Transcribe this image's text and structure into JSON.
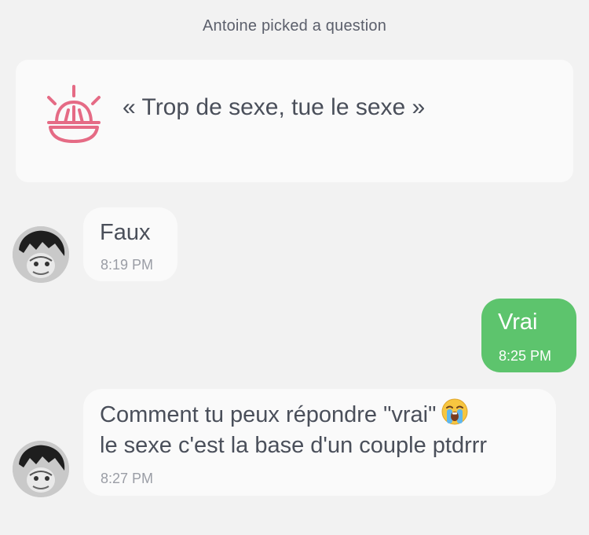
{
  "system_note": "Antoine picked a question",
  "question": {
    "text": "« Trop de sexe, tue le sexe »",
    "icon": "juicer-icon",
    "icon_color": "#e56b85"
  },
  "messages": [
    {
      "direction": "incoming",
      "text": "Faux",
      "time": "8:19 PM"
    },
    {
      "direction": "outgoing",
      "text": "Vrai",
      "time": "8:25 PM"
    },
    {
      "direction": "incoming",
      "lines": [
        "Comment tu peux répondre \"vrai\"",
        "le sexe c'est la base d'un couple ptdrrr"
      ],
      "emoji": "loudly-crying-face-emoji",
      "time": "8:27 PM"
    }
  ],
  "colors": {
    "background": "#f2f2f2",
    "incoming_bubble": "#fafafa",
    "outgoing_bubble": "#5dc46d",
    "text": "#4a4f5a",
    "timestamp": "#9a9da5"
  }
}
